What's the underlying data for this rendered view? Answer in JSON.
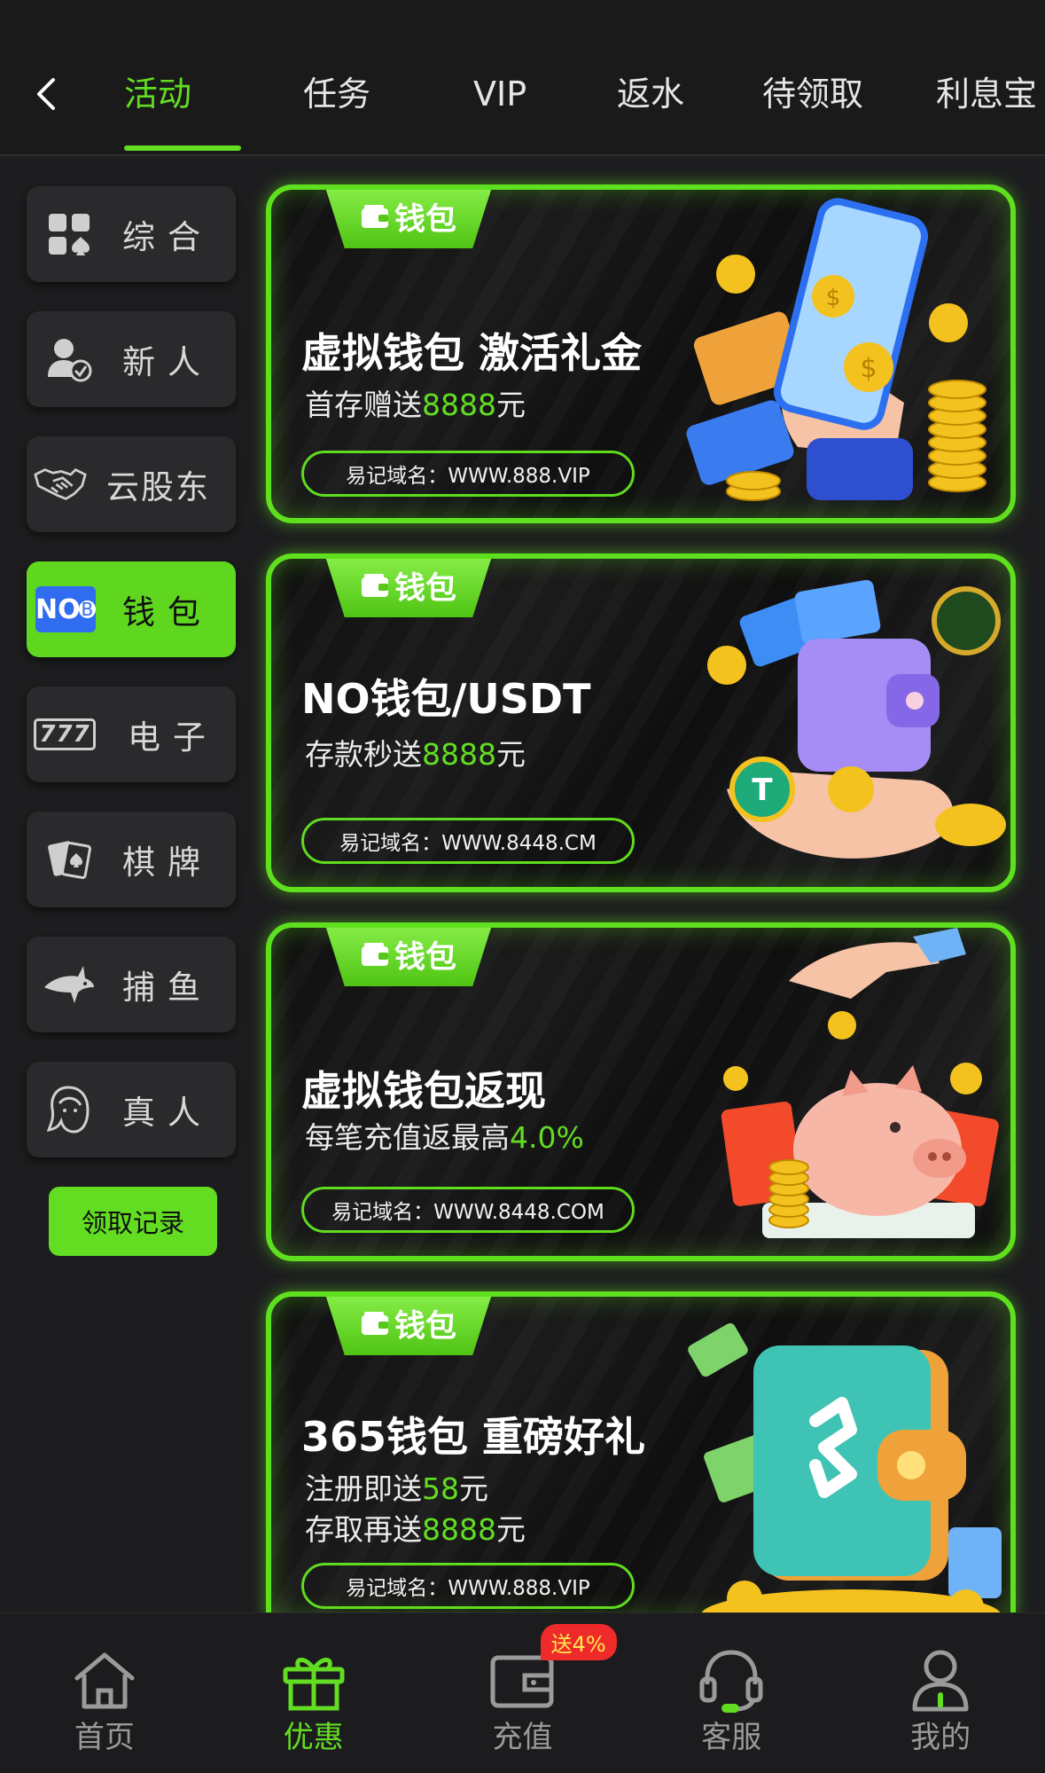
{
  "header": {
    "tabs": [
      {
        "label": "活动",
        "active": true
      },
      {
        "label": "任务",
        "active": false
      },
      {
        "label": "VIP",
        "active": false
      },
      {
        "label": "返水",
        "active": false
      },
      {
        "label": "待领取",
        "active": false
      },
      {
        "label": "利息宝",
        "active": false
      }
    ]
  },
  "sidebar": {
    "items": [
      {
        "label": "综合",
        "icon": "grid-icon"
      },
      {
        "label": "新人",
        "icon": "new-user-icon"
      },
      {
        "label": "云股东",
        "icon": "handshake-icon"
      },
      {
        "label": "钱包",
        "icon": "no-wallet-icon",
        "icon_text": "NO",
        "active": true
      },
      {
        "label": "电子",
        "icon": "slot-777-icon",
        "icon_text": "777"
      },
      {
        "label": "棋牌",
        "icon": "cards-icon"
      },
      {
        "label": "捕鱼",
        "icon": "shark-icon"
      },
      {
        "label": "真人",
        "icon": "live-dealer-icon"
      }
    ],
    "record_button": "领取记录"
  },
  "cards": [
    {
      "tag": "钱包",
      "title": "虚拟钱包 激活礼金",
      "sub_lines": [
        {
          "text": "首存赠送",
          "highlight": "8888",
          "suffix": "元"
        }
      ],
      "domain": "易记域名：WWW.888.VIP"
    },
    {
      "tag": "钱包",
      "title": "NO钱包/USDT",
      "sub_lines": [
        {
          "text": "存款秒送",
          "highlight": "8888",
          "suffix": "元"
        }
      ],
      "domain": "易记域名：WWW.8448.CM"
    },
    {
      "tag": "钱包",
      "title": "虚拟钱包返现",
      "sub_lines": [
        {
          "text": "每笔充值返最高",
          "highlight": "4.0%",
          "suffix": ""
        }
      ],
      "domain": "易记域名：WWW.8448.COM"
    },
    {
      "tag": "钱包",
      "title": "365钱包 重磅好礼",
      "sub_lines": [
        {
          "text": "注册即送",
          "highlight": "58",
          "suffix": "元"
        },
        {
          "text": "存取再送",
          "highlight": "8888",
          "suffix": "元"
        }
      ],
      "domain": "易记域名：WWW.888.VIP"
    }
  ],
  "bottom_nav": {
    "items": [
      {
        "label": "首页",
        "icon": "home-icon"
      },
      {
        "label": "优惠",
        "icon": "gift-icon",
        "active": true
      },
      {
        "label": "充值",
        "icon": "wallet-icon",
        "badge": "送4%"
      },
      {
        "label": "客服",
        "icon": "headset-icon"
      },
      {
        "label": "我的",
        "icon": "user-icon"
      }
    ]
  },
  "colors": {
    "accent": "#62dd22",
    "background": "#1d1d1f",
    "badge": "#ee2a2a"
  }
}
